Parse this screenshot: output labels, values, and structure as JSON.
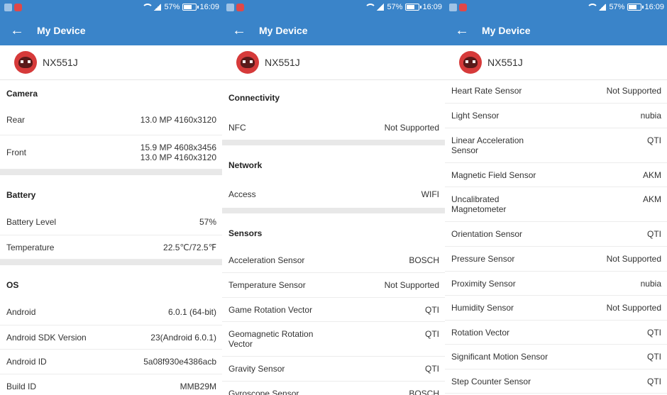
{
  "status": {
    "percent": "57%",
    "time": "16:09",
    "battery_level": 0.57
  },
  "header": {
    "title": "My Device",
    "back_label": "←"
  },
  "device": {
    "name": "NX551J"
  },
  "panel1": {
    "camera": {
      "title": "Camera",
      "rows": [
        {
          "label": "Rear",
          "value": "13.0 MP 4160x3120"
        },
        {
          "label": "Front",
          "value": "15.9 MP 4608x3456",
          "value2": "13.0 MP 4160x3120"
        }
      ]
    },
    "battery": {
      "title": "Battery",
      "rows": [
        {
          "label": "Battery Level",
          "value": "57%"
        },
        {
          "label": "Temperature",
          "value": "22.5℃/72.5℉"
        }
      ]
    },
    "os": {
      "title": "OS",
      "rows": [
        {
          "label": "Android",
          "value": "6.0.1 (64-bit)"
        },
        {
          "label": "Android SDK Version",
          "value": "23(Android 6.0.1)"
        },
        {
          "label": "Android ID",
          "value": "5a08f930e4386acb"
        },
        {
          "label": "Build ID",
          "value": "MMB29M"
        }
      ]
    }
  },
  "panel2": {
    "connectivity": {
      "title": "Connectivity",
      "rows": [
        {
          "label": "NFC",
          "value": "Not Supported"
        }
      ]
    },
    "network": {
      "title": "Network",
      "rows": [
        {
          "label": "Access",
          "value": "WIFI"
        }
      ]
    },
    "sensors": {
      "title": "Sensors",
      "rows": [
        {
          "label": "Acceleration Sensor",
          "value": "BOSCH"
        },
        {
          "label": "Temperature Sensor",
          "value": "Not Supported"
        },
        {
          "label": "Game Rotation Vector",
          "value": "QTI"
        },
        {
          "label": "Geomagnetic Rotation",
          "label2": "Vector",
          "value": "QTI"
        },
        {
          "label": "Gravity Sensor",
          "value": "QTI"
        },
        {
          "label": "Gyroscope Sensor",
          "value": "BOSCH"
        }
      ]
    }
  },
  "panel3": {
    "rows": [
      {
        "label": "Heart Rate Sensor",
        "value": "Not Supported"
      },
      {
        "label": "Light Sensor",
        "value": "nubia"
      },
      {
        "label": "Linear Acceleration",
        "label2": "Sensor",
        "value": "QTI"
      },
      {
        "label": "Magnetic Field Sensor",
        "value": "AKM"
      },
      {
        "label": "Uncalibrated",
        "label2": "Magnetometer",
        "value": "AKM"
      },
      {
        "label": "Orientation Sensor",
        "value": "QTI"
      },
      {
        "label": "Pressure Sensor",
        "value": "Not Supported"
      },
      {
        "label": "Proximity Sensor",
        "value": "nubia"
      },
      {
        "label": "Humidity Sensor",
        "value": "Not Supported"
      },
      {
        "label": "Rotation Vector",
        "value": "QTI"
      },
      {
        "label": "Significant Motion Sensor",
        "value": "QTI"
      },
      {
        "label": "Step Counter Sensor",
        "value": "QTI"
      }
    ]
  }
}
